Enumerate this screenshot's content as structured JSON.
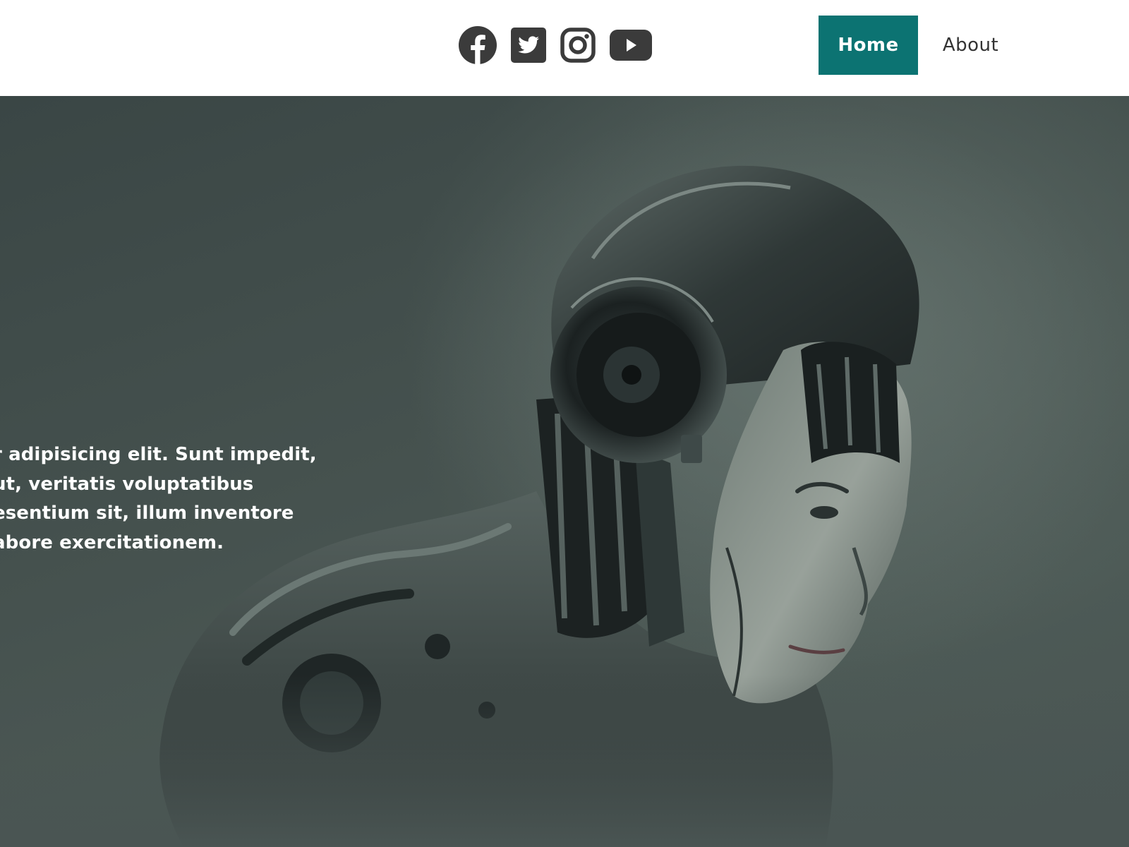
{
  "header": {
    "social_links": [
      {
        "name": "facebook",
        "icon": "facebook-icon"
      },
      {
        "name": "twitter",
        "icon": "twitter-icon"
      },
      {
        "name": "instagram",
        "icon": "instagram-icon"
      },
      {
        "name": "youtube",
        "icon": "youtube-icon"
      }
    ],
    "nav": {
      "home_label": "Home",
      "about_label": "About"
    }
  },
  "hero": {
    "text_lines": [
      "r adipisicing elit. Sunt impedit,",
      "ut, veritatis voluptatibus",
      "esentium sit, illum inventore",
      "abore exercitationem."
    ],
    "image": "robot-portrait-image"
  },
  "colors": {
    "accent": "#0c7372",
    "icon": "#3b3b3b",
    "nav_text": "#333333",
    "hero_bg": "#46524f"
  }
}
